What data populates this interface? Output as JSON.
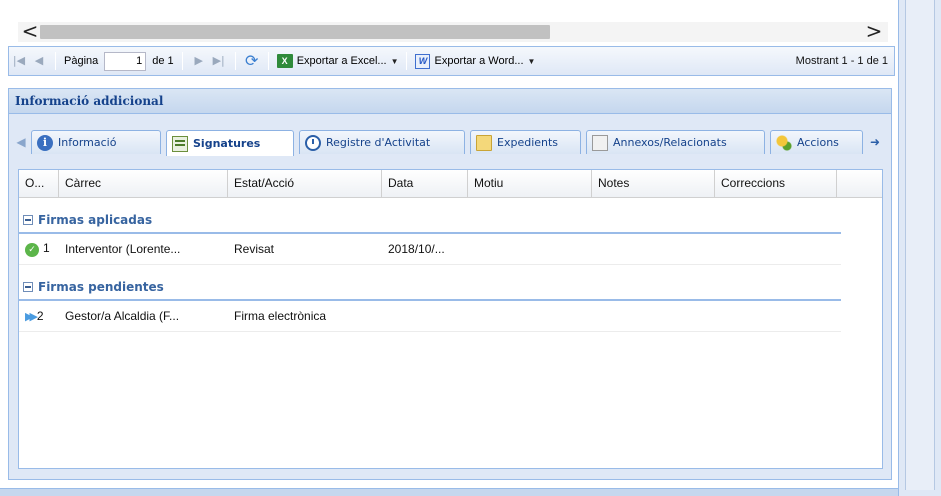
{
  "scrollbar": {
    "left_arrow": "<",
    "right_arrow": ">"
  },
  "toolbar": {
    "page_label": "Pàgina",
    "page_value": "1",
    "of_label": "de 1",
    "export_excel": "Exportar a Excel...",
    "export_word": "Exportar a Word...",
    "excel_icon": "X",
    "word_icon": "W",
    "dropdown_glyph": "▼",
    "displaying": "Mostrant 1 - 1 de 1"
  },
  "panel": {
    "title": "Informació addicional",
    "tabs": [
      {
        "label": "Informació",
        "icon": "info-icon"
      },
      {
        "label": "Signatures",
        "icon": "signature-icon",
        "active": true
      },
      {
        "label": "Registre d'Activitat",
        "icon": "clock-icon"
      },
      {
        "label": "Expedients",
        "icon": "folder-icon"
      },
      {
        "label": "Annexos/Relacionats",
        "icon": "documents-icon"
      },
      {
        "label": "Accions",
        "icon": "coins-icon"
      }
    ]
  },
  "grid": {
    "columns": [
      "O...",
      "Càrrec",
      "Estat/Acció",
      "Data",
      "Motiu",
      "Notes",
      "Correccions"
    ],
    "groups": [
      {
        "title": "Firmas aplicadas",
        "rows": [
          {
            "order": "1",
            "carrec": "Interventor (Lorente...",
            "estat": "Revisat",
            "data": "2018/10/...",
            "motiu": "",
            "notes": "",
            "correccions": ""
          }
        ]
      },
      {
        "title": "Firmas pendientes",
        "rows": [
          {
            "order": "2",
            "carrec": "Gestor/a Alcaldia (F...",
            "estat": "Firma electrònica",
            "data": "",
            "motiu": "",
            "notes": "",
            "correccions": ""
          }
        ]
      }
    ]
  },
  "colors": {
    "accent": "#15428b",
    "border": "#99bbe8",
    "panel_bg": "#dfe8f6"
  }
}
